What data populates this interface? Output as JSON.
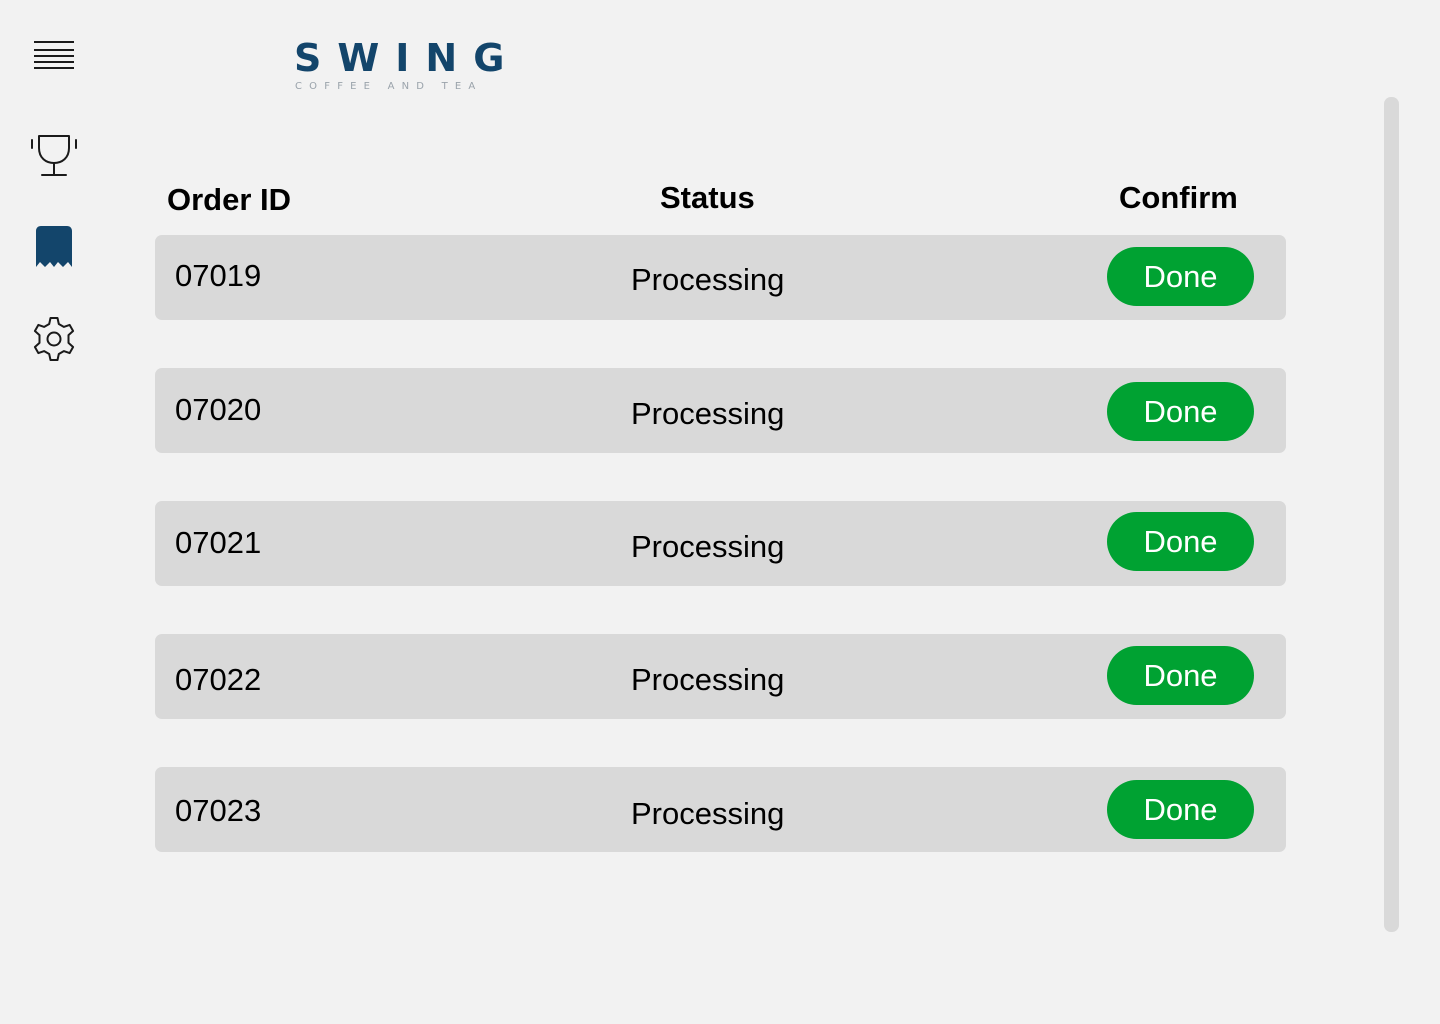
{
  "sidebar": {
    "items": [
      {
        "icon": "menu-icon"
      },
      {
        "icon": "trophy-icon"
      },
      {
        "icon": "orders-icon",
        "active": true
      },
      {
        "icon": "settings-icon"
      }
    ]
  },
  "logo": {
    "wordmark": "SWING",
    "tagline": "COFFEE AND TEA"
  },
  "table": {
    "headers": {
      "order_id": "Order ID",
      "status": "Status",
      "confirm": "Confirm"
    },
    "rows": [
      {
        "id": "07019",
        "status": "Processing",
        "action": "Done"
      },
      {
        "id": "07020",
        "status": "Processing",
        "action": "Done"
      },
      {
        "id": "07021",
        "status": "Processing",
        "action": "Done"
      },
      {
        "id": "07022",
        "status": "Processing",
        "action": "Done"
      },
      {
        "id": "07023",
        "status": "Processing",
        "action": "Done"
      }
    ]
  },
  "colors": {
    "background": "#f2f2f2",
    "row_background": "#d9d9d9",
    "brand": "#13456b",
    "done_button": "#00a232",
    "tagline": "#9aa3ab"
  }
}
